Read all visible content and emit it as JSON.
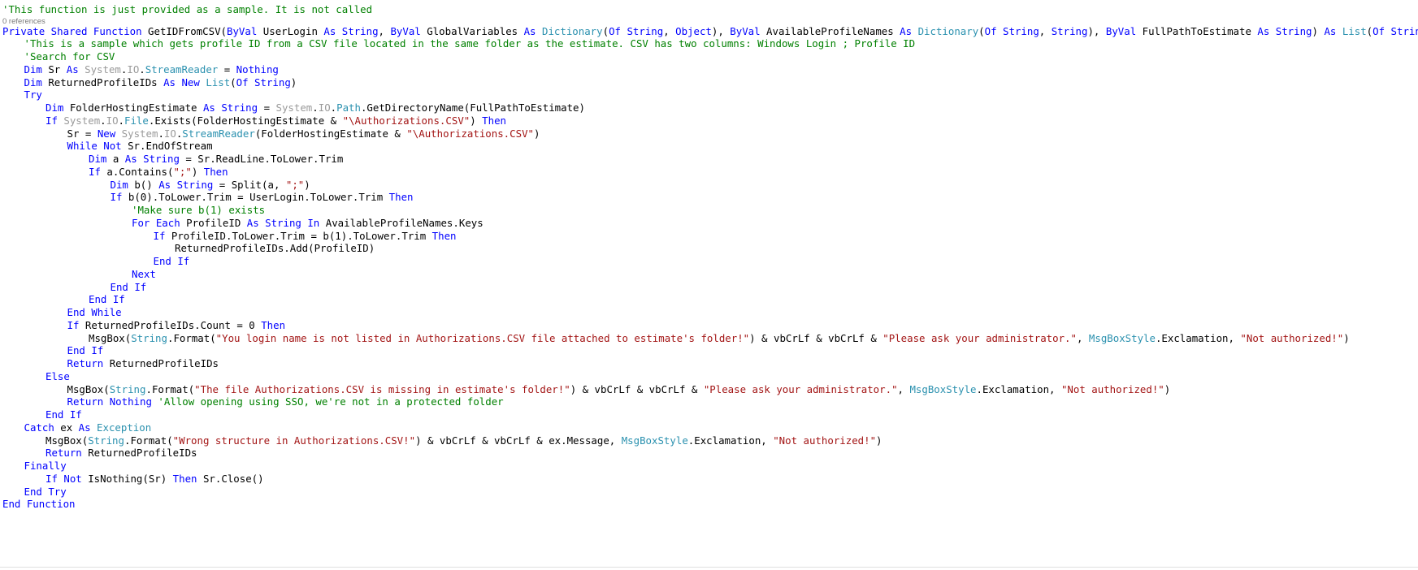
{
  "editor": {
    "codelens": "0 references",
    "colors": {
      "keyword": "#0000ff",
      "type": "#2b91af",
      "namespace": "#9a9a9a",
      "string": "#a31515",
      "comment": "#008000",
      "identifier": "#000000",
      "codelens": "#7a7a7a"
    },
    "lines": [
      {
        "indent": 0,
        "tokens": [
          [
            "com",
            "'This function is just provided as a sample. It is not called"
          ]
        ]
      },
      {
        "indent": 0,
        "tokens": [
          [
            "kw",
            "Private Shared Function"
          ],
          [
            "id",
            " GetIDFromCSV("
          ],
          [
            "kw",
            "ByVal"
          ],
          [
            "id",
            " UserLogin "
          ],
          [
            "kw",
            "As String"
          ],
          [
            "id",
            ", "
          ],
          [
            "kw",
            "ByVal"
          ],
          [
            "id",
            " GlobalVariables "
          ],
          [
            "kw",
            "As"
          ],
          [
            "id",
            " "
          ],
          [
            "type",
            "Dictionary"
          ],
          [
            "id",
            "("
          ],
          [
            "kw",
            "Of String"
          ],
          [
            "id",
            ", "
          ],
          [
            "kw",
            "Object"
          ],
          [
            "id",
            "), "
          ],
          [
            "kw",
            "ByVal"
          ],
          [
            "id",
            " AvailableProfileNames "
          ],
          [
            "kw",
            "As"
          ],
          [
            "id",
            " "
          ],
          [
            "type",
            "Dictionary"
          ],
          [
            "id",
            "("
          ],
          [
            "kw",
            "Of String"
          ],
          [
            "id",
            ", "
          ],
          [
            "kw",
            "String"
          ],
          [
            "id",
            "), "
          ],
          [
            "kw",
            "ByVal"
          ],
          [
            "id",
            " FullPathToEstimate "
          ],
          [
            "kw",
            "As String"
          ],
          [
            "id",
            ") "
          ],
          [
            "kw",
            "As"
          ],
          [
            "id",
            " "
          ],
          [
            "type",
            "List"
          ],
          [
            "id",
            "("
          ],
          [
            "kw",
            "Of String"
          ],
          [
            "id",
            ")"
          ]
        ]
      },
      {
        "indent": 1,
        "tokens": [
          [
            "com",
            "'This is a sample which gets profile ID from a CSV file located in the same folder as the estimate. CSV has two columns: Windows Login ; Profile ID"
          ]
        ]
      },
      {
        "indent": 1,
        "tokens": [
          [
            "com",
            "'Search for CSV"
          ]
        ]
      },
      {
        "indent": 1,
        "tokens": [
          [
            "kw",
            "Dim"
          ],
          [
            "id",
            " Sr "
          ],
          [
            "kw",
            "As"
          ],
          [
            "id",
            " "
          ],
          [
            "ns",
            "System"
          ],
          [
            "id",
            "."
          ],
          [
            "ns",
            "IO"
          ],
          [
            "id",
            "."
          ],
          [
            "type",
            "StreamReader"
          ],
          [
            "id",
            " = "
          ],
          [
            "kw",
            "Nothing"
          ]
        ]
      },
      {
        "indent": 1,
        "tokens": [
          [
            "kw",
            "Dim"
          ],
          [
            "id",
            " ReturnedProfileIDs "
          ],
          [
            "kw",
            "As New"
          ],
          [
            "id",
            " "
          ],
          [
            "type",
            "List"
          ],
          [
            "id",
            "("
          ],
          [
            "kw",
            "Of String"
          ],
          [
            "id",
            ")"
          ]
        ]
      },
      {
        "indent": 1,
        "tokens": [
          [
            "kw",
            "Try"
          ]
        ]
      },
      {
        "indent": 2,
        "tokens": [
          [
            "kw",
            "Dim"
          ],
          [
            "id",
            " FolderHostingEstimate "
          ],
          [
            "kw",
            "As String"
          ],
          [
            "id",
            " = "
          ],
          [
            "ns",
            "System"
          ],
          [
            "id",
            "."
          ],
          [
            "ns",
            "IO"
          ],
          [
            "id",
            "."
          ],
          [
            "type",
            "Path"
          ],
          [
            "id",
            ".GetDirectoryName(FullPathToEstimate)"
          ]
        ]
      },
      {
        "indent": 2,
        "tokens": [
          [
            "kw",
            "If"
          ],
          [
            "id",
            " "
          ],
          [
            "ns",
            "System"
          ],
          [
            "id",
            "."
          ],
          [
            "ns",
            "IO"
          ],
          [
            "id",
            "."
          ],
          [
            "type",
            "File"
          ],
          [
            "id",
            ".Exists(FolderHostingEstimate & "
          ],
          [
            "str",
            "\"\\Authorizations.CSV\""
          ],
          [
            "id",
            ") "
          ],
          [
            "kw",
            "Then"
          ]
        ]
      },
      {
        "indent": 3,
        "tokens": [
          [
            "id",
            "Sr = "
          ],
          [
            "kw",
            "New"
          ],
          [
            "id",
            " "
          ],
          [
            "ns",
            "System"
          ],
          [
            "id",
            "."
          ],
          [
            "ns",
            "IO"
          ],
          [
            "id",
            "."
          ],
          [
            "type",
            "StreamReader"
          ],
          [
            "id",
            "(FolderHostingEstimate & "
          ],
          [
            "str",
            "\"\\Authorizations.CSV\""
          ],
          [
            "id",
            ")"
          ]
        ]
      },
      {
        "indent": 3,
        "tokens": [
          [
            "kw",
            "While Not"
          ],
          [
            "id",
            " Sr.EndOfStream"
          ]
        ]
      },
      {
        "indent": 4,
        "tokens": [
          [
            "kw",
            "Dim"
          ],
          [
            "id",
            " a "
          ],
          [
            "kw",
            "As String"
          ],
          [
            "id",
            " = Sr.ReadLine.ToLower.Trim"
          ]
        ]
      },
      {
        "indent": 4,
        "tokens": [
          [
            "kw",
            "If"
          ],
          [
            "id",
            " a.Contains("
          ],
          [
            "str",
            "\";\""
          ],
          [
            "id",
            ") "
          ],
          [
            "kw",
            "Then"
          ]
        ]
      },
      {
        "indent": 5,
        "tokens": [
          [
            "kw",
            "Dim"
          ],
          [
            "id",
            " b() "
          ],
          [
            "kw",
            "As String"
          ],
          [
            "id",
            " = Split(a, "
          ],
          [
            "str",
            "\";\""
          ],
          [
            "id",
            ")"
          ]
        ]
      },
      {
        "indent": 5,
        "tokens": [
          [
            "kw",
            "If"
          ],
          [
            "id",
            " b(0).ToLower.Trim = UserLogin.ToLower.Trim "
          ],
          [
            "kw",
            "Then"
          ]
        ]
      },
      {
        "indent": 6,
        "tokens": [
          [
            "com",
            "'Make sure b(1) exists"
          ]
        ]
      },
      {
        "indent": 6,
        "tokens": [
          [
            "kw",
            "For Each"
          ],
          [
            "id",
            " ProfileID "
          ],
          [
            "kw",
            "As String In"
          ],
          [
            "id",
            " AvailableProfileNames.Keys"
          ]
        ]
      },
      {
        "indent": 7,
        "tokens": [
          [
            "kw",
            "If"
          ],
          [
            "id",
            " ProfileID.ToLower.Trim = b(1).ToLower.Trim "
          ],
          [
            "kw",
            "Then"
          ]
        ]
      },
      {
        "indent": 8,
        "tokens": [
          [
            "id",
            "ReturnedProfileIDs.Add(ProfileID)"
          ]
        ]
      },
      {
        "indent": 7,
        "tokens": [
          [
            "kw",
            "End If"
          ]
        ]
      },
      {
        "indent": 6,
        "tokens": [
          [
            "kw",
            "Next"
          ]
        ]
      },
      {
        "indent": 5,
        "tokens": [
          [
            "kw",
            "End If"
          ]
        ]
      },
      {
        "indent": 4,
        "tokens": [
          [
            "kw",
            "End If"
          ]
        ]
      },
      {
        "indent": 3,
        "tokens": [
          [
            "kw",
            "End While"
          ]
        ]
      },
      {
        "indent": 3,
        "tokens": [
          [
            "kw",
            "If"
          ],
          [
            "id",
            " ReturnedProfileIDs.Count = 0 "
          ],
          [
            "kw",
            "Then"
          ]
        ]
      },
      {
        "indent": 4,
        "tokens": [
          [
            "id",
            "MsgBox("
          ],
          [
            "type",
            "String"
          ],
          [
            "id",
            ".Format("
          ],
          [
            "str",
            "\"You login name is not listed in Authorizations.CSV file attached to estimate's folder!\""
          ],
          [
            "id",
            ") & vbCrLf & vbCrLf & "
          ],
          [
            "str",
            "\"Please ask your administrator.\""
          ],
          [
            "id",
            ", "
          ],
          [
            "type",
            "MsgBoxStyle"
          ],
          [
            "id",
            ".Exclamation, "
          ],
          [
            "str",
            "\"Not authorized!\""
          ],
          [
            "id",
            ")"
          ]
        ]
      },
      {
        "indent": 3,
        "tokens": [
          [
            "kw",
            "End If"
          ]
        ]
      },
      {
        "indent": 3,
        "tokens": [
          [
            "kw",
            "Return"
          ],
          [
            "id",
            " ReturnedProfileIDs"
          ]
        ]
      },
      {
        "indent": 2,
        "tokens": [
          [
            "kw",
            "Else"
          ]
        ]
      },
      {
        "indent": 3,
        "tokens": [
          [
            "id",
            "MsgBox("
          ],
          [
            "type",
            "String"
          ],
          [
            "id",
            ".Format("
          ],
          [
            "str",
            "\"The file Authorizations.CSV is missing in estimate's folder!\""
          ],
          [
            "id",
            ") & vbCrLf & vbCrLf & "
          ],
          [
            "str",
            "\"Please ask your administrator.\""
          ],
          [
            "id",
            ", "
          ],
          [
            "type",
            "MsgBoxStyle"
          ],
          [
            "id",
            ".Exclamation, "
          ],
          [
            "str",
            "\"Not authorized!\""
          ],
          [
            "id",
            ")"
          ]
        ]
      },
      {
        "indent": 3,
        "tokens": [
          [
            "kw",
            "Return Nothing"
          ],
          [
            "id",
            " "
          ],
          [
            "com",
            "'Allow opening using SSO, we're not in a protected folder"
          ]
        ]
      },
      {
        "indent": 2,
        "tokens": [
          [
            "kw",
            "End If"
          ]
        ]
      },
      {
        "indent": 1,
        "tokens": [
          [
            "kw",
            "Catch"
          ],
          [
            "id",
            " ex "
          ],
          [
            "kw",
            "As"
          ],
          [
            "id",
            " "
          ],
          [
            "type",
            "Exception"
          ]
        ]
      },
      {
        "indent": 2,
        "tokens": [
          [
            "id",
            "MsgBox("
          ],
          [
            "type",
            "String"
          ],
          [
            "id",
            ".Format("
          ],
          [
            "str",
            "\"Wrong structure in Authorizations.CSV!\""
          ],
          [
            "id",
            ") & vbCrLf & vbCrLf & ex.Message, "
          ],
          [
            "type",
            "MsgBoxStyle"
          ],
          [
            "id",
            ".Exclamation, "
          ],
          [
            "str",
            "\"Not authorized!\""
          ],
          [
            "id",
            ")"
          ]
        ]
      },
      {
        "indent": 2,
        "tokens": [
          [
            "kw",
            "Return"
          ],
          [
            "id",
            " ReturnedProfileIDs"
          ]
        ]
      },
      {
        "indent": 1,
        "tokens": [
          [
            "kw",
            "Finally"
          ]
        ]
      },
      {
        "indent": 2,
        "tokens": [
          [
            "kw",
            "If Not"
          ],
          [
            "id",
            " IsNothing(Sr) "
          ],
          [
            "kw",
            "Then"
          ],
          [
            "id",
            " Sr.Close()"
          ]
        ]
      },
      {
        "indent": 1,
        "tokens": [
          [
            "kw",
            "End Try"
          ]
        ]
      },
      {
        "indent": 0,
        "tokens": [
          [
            "kw",
            "End Function"
          ]
        ]
      }
    ]
  }
}
